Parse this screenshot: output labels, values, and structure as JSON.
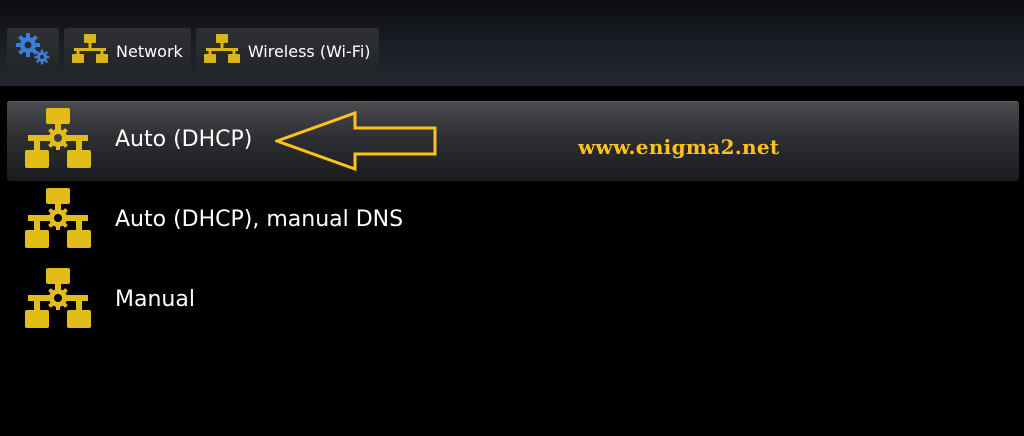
{
  "breadcrumbs": [
    {
      "label": "",
      "icon": "gears-icon"
    },
    {
      "label": "Network",
      "icon": "network-icon"
    },
    {
      "label": "Wireless (Wi-Fi)",
      "icon": "network-icon"
    }
  ],
  "menu": {
    "items": [
      {
        "label": "Auto (DHCP)",
        "icon": "network-settings-icon",
        "selected": true
      },
      {
        "label": "Auto (DHCP), manual DNS",
        "icon": "network-settings-icon",
        "selected": false
      },
      {
        "label": "Manual",
        "icon": "network-settings-icon",
        "selected": false
      }
    ]
  },
  "watermark": "www.enigma2.net",
  "colors": {
    "accent": "#e8c21a",
    "icon_blue": "#3a7fd6",
    "background": "#000000",
    "watermark": "#ffc21a"
  }
}
